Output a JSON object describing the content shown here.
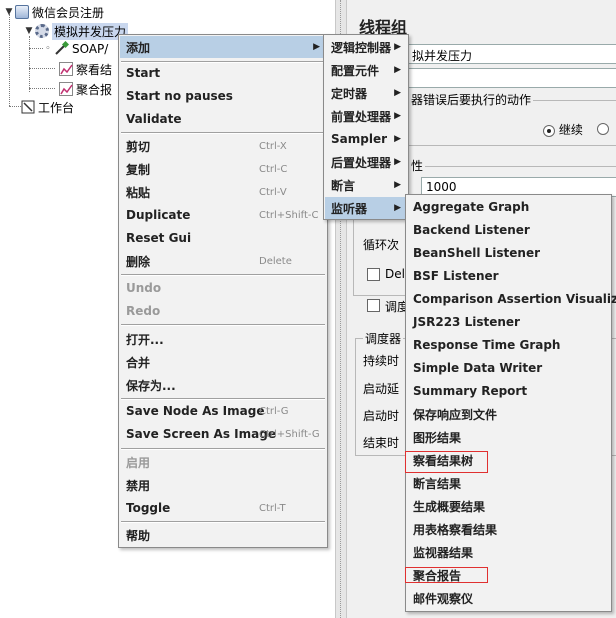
{
  "tree": {
    "root": "微信会员注册",
    "thread_group": "模拟并发压力",
    "soap_item": "SOAP/",
    "view_results_item": "察看结",
    "aggregate_item": "聚合报",
    "workbench": "工作台"
  },
  "right_panel": {
    "title": "线程组",
    "name_value": "拟并发压力",
    "error_action_label": "器错误后要执行的动作",
    "continue_label": "继续",
    "property_label": "性",
    "threads_value": "1000",
    "loop_label": "循环次",
    "delay_label": "Dela",
    "scheduler_label": "调度",
    "scheduler_box_label": "调度器",
    "duration_label": "持续时",
    "startup_delay_label": "启动延",
    "start_time_label": "启动时",
    "end_time_label": "结束时"
  },
  "context_menu": {
    "items": [
      {
        "label": "添加",
        "submenu": true
      },
      {
        "label": "Start"
      },
      {
        "label": "Start no pauses"
      },
      {
        "label": "Validate"
      },
      {
        "label": "剪切",
        "shortcut": "Ctrl-X"
      },
      {
        "label": "复制",
        "shortcut": "Ctrl-C"
      },
      {
        "label": "粘贴",
        "shortcut": "Ctrl-V"
      },
      {
        "label": "Duplicate",
        "shortcut": "Ctrl+Shift-C"
      },
      {
        "label": "Reset Gui"
      },
      {
        "label": "删除",
        "shortcut": "Delete"
      },
      {
        "label": "Undo",
        "disabled": true
      },
      {
        "label": "Redo",
        "disabled": true
      },
      {
        "label": "打开..."
      },
      {
        "label": "合并"
      },
      {
        "label": "保存为..."
      },
      {
        "label": "Save Node As Image",
        "shortcut": "Ctrl-G"
      },
      {
        "label": "Save Screen As Image",
        "shortcut": "Ctrl+Shift-G"
      },
      {
        "label": "启用",
        "disabled": true
      },
      {
        "label": "禁用"
      },
      {
        "label": "Toggle",
        "shortcut": "Ctrl-T"
      },
      {
        "label": "帮助"
      }
    ]
  },
  "add_submenu": {
    "items": [
      "逻辑控制器",
      "配置元件",
      "定时器",
      "前置处理器",
      "Sampler",
      "后置处理器",
      "断言",
      "监听器"
    ]
  },
  "listener_submenu": {
    "items": [
      "Aggregate Graph",
      "Backend Listener",
      "BeanShell Listener",
      "BSF Listener",
      "Comparison Assertion Visualizer",
      "JSR223 Listener",
      "Response Time Graph",
      "Simple Data Writer",
      "Summary Report",
      "保存响应到文件",
      "图形结果",
      "察看结果树",
      "断言结果",
      "生成概要结果",
      "用表格察看结果",
      "监视器结果",
      "聚合报告",
      "邮件观察仪"
    ]
  },
  "colors": {
    "highlight": "#b8cfe5",
    "annotation": "#e03030",
    "menu_bg": "#f2f2f2"
  },
  "icons": {
    "arrow": "▶",
    "expanded": "▼"
  }
}
